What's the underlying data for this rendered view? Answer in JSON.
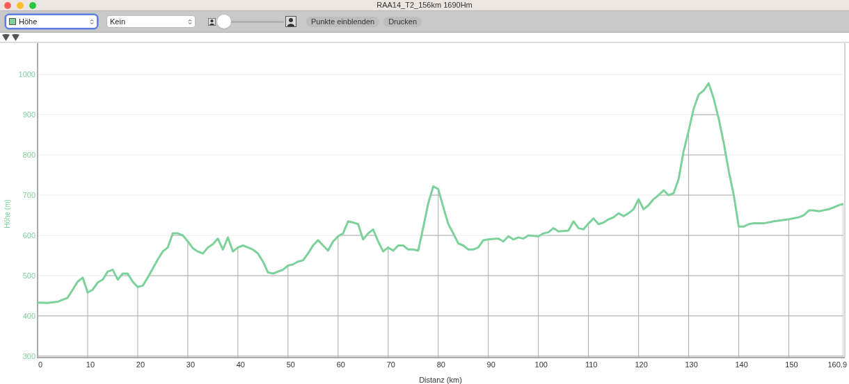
{
  "window": {
    "title": "RAA14_T2_156km 1690Hm"
  },
  "toolbar": {
    "metric_select": {
      "value": "Höhe",
      "color": "#7dd19b",
      "focused": true
    },
    "compare_select": {
      "value": "Kein",
      "focused": false
    },
    "photo_slider": {
      "level": 0
    },
    "buttons": [
      "Punkte einblenden",
      "Drucken"
    ]
  },
  "chart_data": {
    "type": "line",
    "xlabel": "Distanz (km)",
    "ylabel": "Höhe (m)",
    "xlim": [
      0,
      160.9
    ],
    "ylim": [
      298,
      1078
    ],
    "xticks": [
      0,
      10,
      20,
      30,
      40,
      50,
      60,
      70,
      80,
      90,
      100,
      110,
      120,
      130,
      140,
      150,
      160.9
    ],
    "yticks": [
      300,
      400,
      500,
      600,
      700,
      800,
      900,
      1000
    ],
    "x": [
      0,
      2,
      4,
      6,
      7,
      8,
      9,
      10,
      11,
      12,
      13,
      14,
      15,
      16,
      17,
      18,
      19,
      20,
      21,
      22,
      24,
      25,
      26,
      27,
      28,
      29,
      30,
      31,
      32,
      33,
      34,
      35,
      36,
      37,
      38,
      39,
      40,
      41,
      42,
      43,
      44,
      45,
      46,
      47,
      48,
      49,
      50,
      51,
      52,
      53,
      54,
      55,
      56,
      57,
      58,
      59,
      60,
      61,
      62,
      63,
      64,
      65,
      66,
      67,
      68,
      69,
      70,
      71,
      72,
      73,
      74,
      75,
      76,
      77,
      78,
      79,
      80,
      81,
      82,
      83,
      84,
      85,
      86,
      87,
      88,
      89,
      90,
      92,
      93,
      94,
      95,
      96,
      97,
      98,
      100,
      101,
      102,
      103,
      104,
      106,
      107,
      108,
      109,
      110,
      111,
      112,
      113,
      114,
      115,
      116,
      117,
      118,
      119,
      120,
      121,
      122,
      123,
      124,
      125,
      126,
      127,
      128,
      129,
      130,
      131,
      132,
      133,
      134,
      135,
      136,
      137,
      138,
      139,
      140,
      141,
      142,
      143,
      145,
      147,
      150,
      152,
      153,
      154,
      155,
      156,
      158,
      160,
      160.9
    ],
    "grid": true,
    "series": [
      {
        "color": "#7dd19b",
        "values": [
          433,
          432,
          435,
          445,
          465,
          485,
          495,
          458,
          465,
          483,
          490,
          510,
          515,
          490,
          505,
          505,
          485,
          472,
          475,
          495,
          540,
          560,
          570,
          605,
          605,
          600,
          585,
          568,
          560,
          555,
          570,
          578,
          592,
          565,
          595,
          560,
          570,
          575,
          570,
          565,
          555,
          535,
          508,
          505,
          510,
          515,
          525,
          528,
          535,
          538,
          555,
          575,
          588,
          575,
          562,
          585,
          598,
          605,
          635,
          632,
          628,
          590,
          605,
          615,
          585,
          560,
          570,
          562,
          575,
          575,
          565,
          565,
          562,
          620,
          680,
          722,
          715,
          670,
          628,
          605,
          580,
          575,
          565,
          565,
          570,
          588,
          590,
          592,
          585,
          598,
          590,
          595,
          592,
          600,
          598,
          605,
          608,
          618,
          610,
          612,
          635,
          618,
          615,
          630,
          642,
          628,
          632,
          640,
          645,
          655,
          648,
          655,
          665,
          690,
          665,
          675,
          690,
          700,
          712,
          700,
          705,
          740,
          810,
          860,
          915,
          950,
          960,
          978,
          940,
          890,
          830,
          760,
          700,
          622,
          622,
          628,
          630,
          630,
          635,
          640,
          645,
          650,
          662,
          662,
          660,
          665,
          675,
          678
        ]
      }
    ]
  }
}
